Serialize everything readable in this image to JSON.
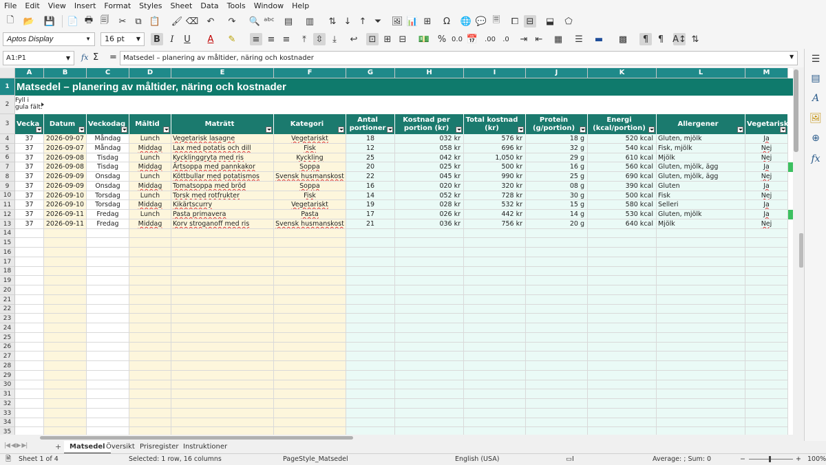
{
  "menu": [
    "File",
    "Edit",
    "View",
    "Insert",
    "Format",
    "Styles",
    "Sheet",
    "Data",
    "Tools",
    "Window",
    "Help"
  ],
  "toolbar": {
    "font_name": "Aptos Display",
    "font_size": "16 pt"
  },
  "formula_bar": {
    "name_box": "A1:P1",
    "fx": "fx",
    "sum": "Σ",
    "equals": "=",
    "content": "Matsedel – planering av måltider, näring och kostnader"
  },
  "columns": [
    "A",
    "B",
    "C",
    "D",
    "E",
    "F",
    "G",
    "H",
    "I",
    "J",
    "K",
    "L",
    "M"
  ],
  "sheet": {
    "title": "Matsedel – planering av måltider, näring och kostnader",
    "note": "Fyll i gula fält.",
    "headers": [
      "Vecka",
      "Datum",
      "Veckodag",
      "Måltid",
      "Maträtt",
      "Kategori",
      "Antal portioner",
      "Kostnad per portion (kr)",
      "Total kostnad (kr)",
      "Protein (g/portion)",
      "Energi (kcal/portion)",
      "Allergener",
      "Vegetarisk?"
    ],
    "rows": [
      [
        "37",
        "2026-09-07",
        "Måndag",
        "Lunch",
        "Vegetarisk lasagne",
        "Vegetariskt",
        "18",
        "032 kr",
        "576 kr",
        "18 g",
        "520 kcal",
        "Gluten, mjölk",
        "Ja"
      ],
      [
        "37",
        "2026-09-07",
        "Måndag",
        "Middag",
        "Lax med potatis och dill",
        "Fisk",
        "12",
        "058 kr",
        "696 kr",
        "32 g",
        "540 kcal",
        "Fisk, mjölk",
        "Nej"
      ],
      [
        "37",
        "2026-09-08",
        "Tisdag",
        "Lunch",
        "Kycklinggryta med ris",
        "Kyckling",
        "25",
        "042 kr",
        "1,050 kr",
        "29 g",
        "610 kcal",
        "Mjölk",
        "Nej"
      ],
      [
        "37",
        "2026-09-08",
        "Tisdag",
        "Middag",
        "Ärtsoppa med pannkakor",
        "Soppa",
        "20",
        "025 kr",
        "500 kr",
        "16 g",
        "560 kcal",
        "Gluten, mjölk, ägg",
        "Ja"
      ],
      [
        "37",
        "2026-09-09",
        "Onsdag",
        "Lunch",
        "Köttbullar med potatismos",
        "Svensk husmanskost",
        "22",
        "045 kr",
        "990 kr",
        "25 g",
        "690 kcal",
        "Gluten, mjölk, ägg",
        "Nej"
      ],
      [
        "37",
        "2026-09-09",
        "Onsdag",
        "Middag",
        "Tomatsoppa med bröd",
        "Soppa",
        "16",
        "020 kr",
        "320 kr",
        "08 g",
        "390 kcal",
        "Gluten",
        "Ja"
      ],
      [
        "37",
        "2026-09-10",
        "Torsdag",
        "Lunch",
        "Torsk med rotfrukter",
        "Fisk",
        "14",
        "052 kr",
        "728 kr",
        "30 g",
        "500 kcal",
        "Fisk",
        "Nej"
      ],
      [
        "37",
        "2026-09-10",
        "Torsdag",
        "Middag",
        "Kikärtscurry",
        "Vegetariskt",
        "19",
        "028 kr",
        "532 kr",
        "15 g",
        "580 kcal",
        "Selleri",
        "Ja"
      ],
      [
        "37",
        "2026-09-11",
        "Fredag",
        "Lunch",
        "Pasta primavera",
        "Pasta",
        "17",
        "026 kr",
        "442 kr",
        "14 g",
        "530 kcal",
        "Gluten, mjölk",
        "Ja"
      ],
      [
        "37",
        "2026-09-11",
        "Fredag",
        "Middag",
        "Korv stroganoff med ris",
        "Svensk husmanskost",
        "21",
        "036 kr",
        "756 kr",
        "20 g",
        "640 kcal",
        "Mjölk",
        "Nej"
      ]
    ]
  },
  "row_numbers": [
    "1",
    "2",
    "3",
    "4",
    "5",
    "6",
    "7",
    "8",
    "9",
    "10",
    "11",
    "12",
    "13",
    "14",
    "15",
    "16",
    "17",
    "18",
    "19",
    "20",
    "21",
    "22",
    "23",
    "24",
    "25",
    "26",
    "27",
    "28",
    "29",
    "30",
    "31",
    "32",
    "33",
    "34",
    "35"
  ],
  "tabs": [
    "Matsedel",
    "Översikt",
    "Prisregister",
    "Instruktioner"
  ],
  "status": {
    "sheet": "Sheet 1 of 4",
    "selection": "Selected: 1 row, 16 columns",
    "page_style": "PageStyle_Matsedel",
    "language": "English (USA)",
    "summary": "Average: ; Sum: 0",
    "zoom": "100%"
  },
  "colors": {
    "header_teal": "#1b7a6e",
    "title_teal": "#0f7a6c",
    "input_yellow": "#fdf6dc",
    "row_mint": "#eafaf6"
  }
}
